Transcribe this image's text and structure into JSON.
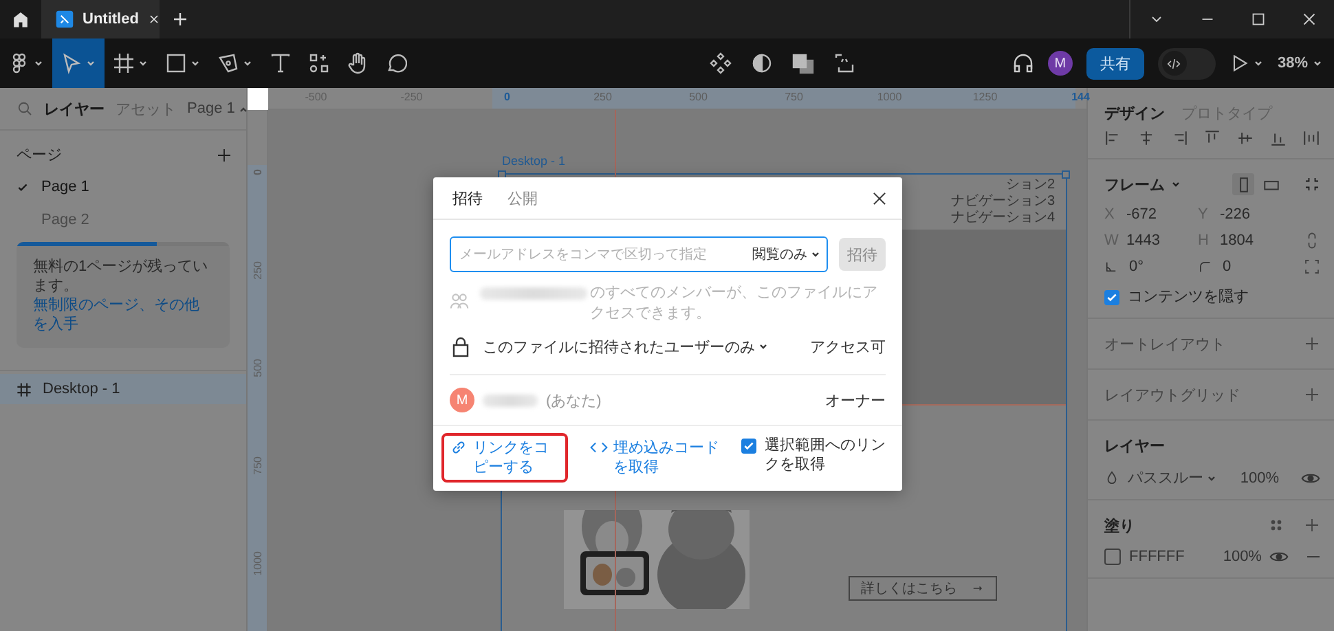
{
  "window": {
    "tab_title": "Untitled"
  },
  "toolbar": {
    "tools": [
      {
        "kind": "main-menu",
        "selected": false
      },
      {
        "kind": "move",
        "selected": true
      },
      {
        "kind": "frame",
        "selected": false
      },
      {
        "kind": "shape",
        "selected": false
      },
      {
        "kind": "pen",
        "selected": false
      },
      {
        "kind": "text",
        "selected": false
      },
      {
        "kind": "resources",
        "selected": false
      },
      {
        "kind": "hand",
        "selected": false
      },
      {
        "kind": "comment",
        "selected": false
      }
    ],
    "avatar": "M",
    "share_button": "共有",
    "dev_mode": false,
    "zoom": "38%"
  },
  "left_panel": {
    "tabs": [
      {
        "label": "レイヤー",
        "selected": true
      },
      {
        "label": "アセット",
        "selected": false
      }
    ],
    "page_menu": "Page 1",
    "pages_title": "ページ",
    "pages": [
      {
        "label": "Page 1",
        "selected": true
      },
      {
        "label": "Page 2",
        "selected": false
      }
    ],
    "usage": {
      "level": 0.66,
      "message": "無料の1ページが残っています。",
      "link": "無制限のページ、その他を入手"
    },
    "layers": [
      {
        "label": "Desktop - 1",
        "selected": true
      }
    ]
  },
  "rulers": {
    "top": [
      {
        "label": "-500",
        "highlighted": false
      },
      {
        "label": "-250",
        "highlighted": false
      },
      {
        "label": "0",
        "highlighted": true
      },
      {
        "label": "250",
        "highlighted": false
      },
      {
        "label": "500",
        "highlighted": false
      },
      {
        "label": "750",
        "highlighted": false
      },
      {
        "label": "1000",
        "highlighted": false
      },
      {
        "label": "1250",
        "highlighted": false
      },
      {
        "label": "144",
        "highlighted": true
      }
    ],
    "left": [
      {
        "label": "0",
        "highlighted": true
      },
      {
        "label": "250",
        "highlighted": false
      },
      {
        "label": "500",
        "highlighted": false
      },
      {
        "label": "750",
        "highlighted": false
      },
      {
        "label": "1000",
        "highlighted": false
      }
    ]
  },
  "canvas": {
    "frame_label": "Desktop - 1",
    "nav_items": [
      "ション2",
      "ナビゲーション3",
      "ナビゲーション4"
    ],
    "cta_button": "詳しくはこちら"
  },
  "share_dialog": {
    "tabs": [
      {
        "label": "招待",
        "selected": true
      },
      {
        "label": "公開",
        "selected": false
      }
    ],
    "email_placeholder": "メールアドレスをコンマで区切って指定",
    "role": "閲覧のみ",
    "invite_button": {
      "label": "招待",
      "disabled": true
    },
    "team_notice": "のすべてのメンバーが、このファイルにアクセスできます。",
    "access_scope": "このファイルに招待されたユーザーのみ",
    "access_level": "アクセス可",
    "members": [
      {
        "avatar": "M",
        "suffix": "(あなた)",
        "role": "オーナー"
      }
    ],
    "footer": {
      "copy_link": {
        "label": "リンクをコピーする",
        "highlighted": true
      },
      "embed": "埋め込みコードを取得",
      "selection_link": {
        "label": "選択範囲へのリンクを取得",
        "checked": true
      }
    }
  },
  "right_panel": {
    "tabs": [
      {
        "label": "デザイン",
        "selected": true
      },
      {
        "label": "プロトタイプ",
        "selected": false
      }
    ],
    "frame": {
      "title": "フレーム",
      "orientation": [
        {
          "kind": "portrait",
          "selected": true
        },
        {
          "kind": "landscape",
          "selected": false
        }
      ],
      "fields": [
        {
          "kind": "labeled",
          "label": "X",
          "value": "-672"
        },
        {
          "kind": "labeled",
          "label": "Y",
          "value": "-226"
        },
        {
          "kind": "labeled",
          "label": "W",
          "value": "1443"
        },
        {
          "kind": "labeled",
          "label": "H",
          "value": "1804"
        },
        {
          "kind": "rotation",
          "value": "0°"
        },
        {
          "kind": "radius",
          "value": "0"
        }
      ],
      "clip_content": {
        "label": "コンテンツを隠す",
        "checked": true
      }
    },
    "auto_layout": "オートレイアウト",
    "layout_grid": "レイアウトグリッド",
    "layer": {
      "title": "レイヤー",
      "blend": "パススルー",
      "opacity": "100%",
      "visible": true
    },
    "fill": {
      "title": "塗り",
      "items": [
        {
          "hex": "FFFFFF",
          "opacity": "100%",
          "visible": true
        }
      ]
    }
  }
}
